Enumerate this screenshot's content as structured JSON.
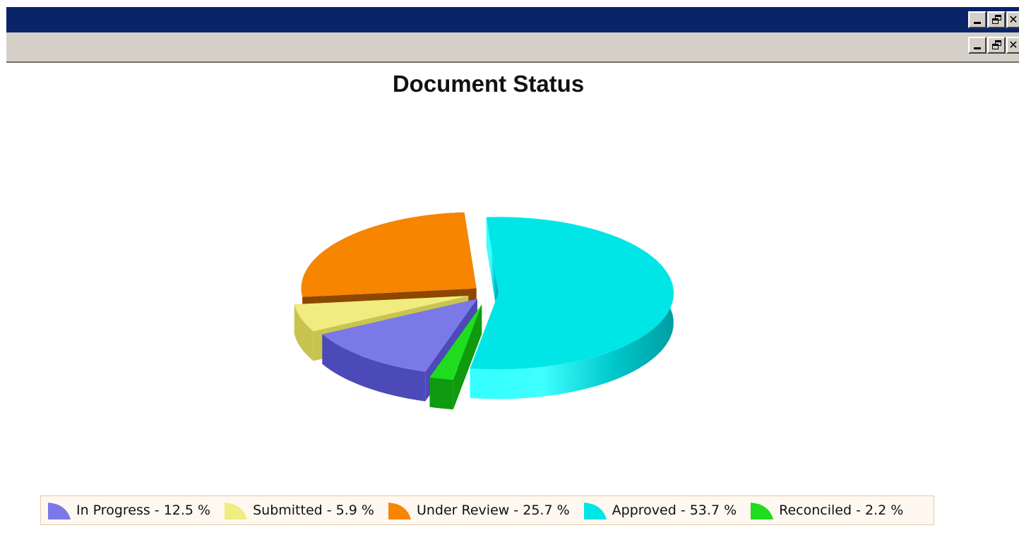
{
  "window": {
    "controls": [
      "minimize",
      "restore",
      "close"
    ],
    "close_glyph": "✕"
  },
  "chart_data": {
    "type": "pie",
    "title": "Document Status",
    "categories": [
      "In Progress",
      "Submitted",
      "Under Review",
      "Approved",
      "Reconciled"
    ],
    "values": [
      12.5,
      5.9,
      25.7,
      53.7,
      2.2
    ],
    "unit": "%",
    "colors": [
      "#7b78e8",
      "#f0ec80",
      "#f78500",
      "#00e6e6",
      "#1fdc1f"
    ],
    "style": "3d-exploded",
    "legend": {
      "placement": "bottom",
      "entries": [
        "In Progress - 12.5 %",
        "Submitted - 5.9 %",
        "Under Review - 25.7 %",
        "Approved - 53.7 %",
        "Reconciled - 2.2 %"
      ]
    }
  }
}
